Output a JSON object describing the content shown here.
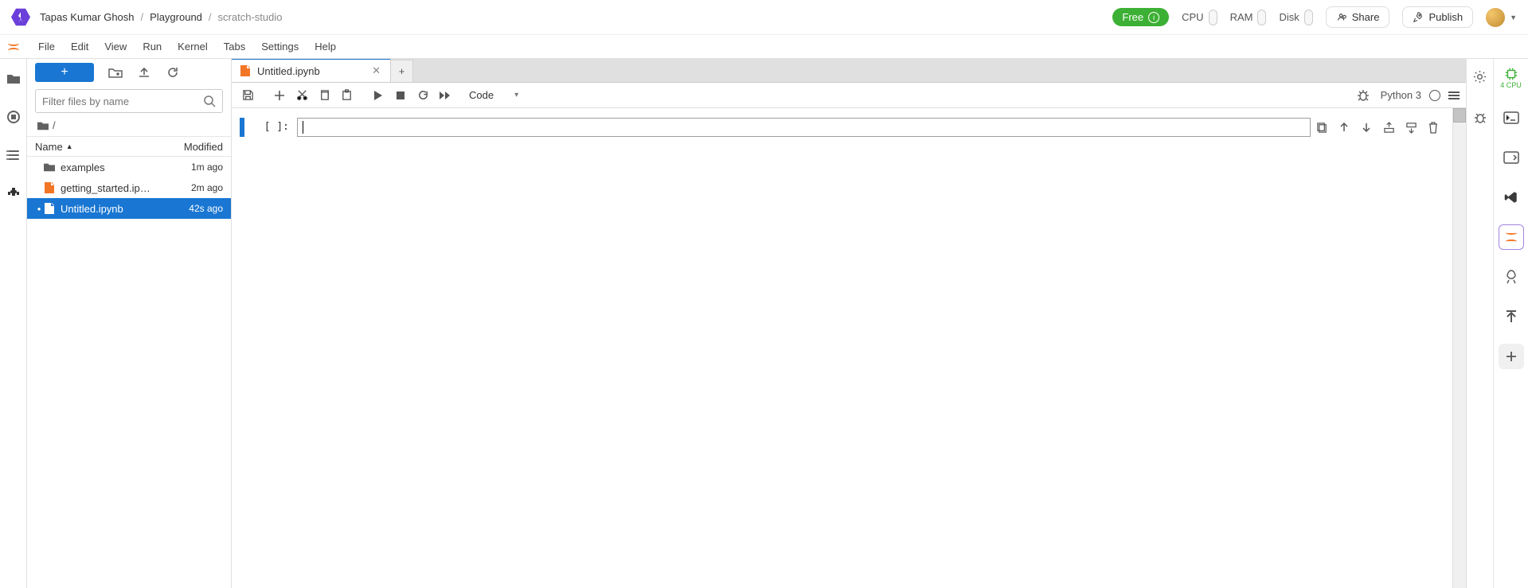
{
  "breadcrumbs": {
    "owner": "Tapas Kumar Ghosh",
    "folder": "Playground",
    "project": "scratch-studio"
  },
  "plan": {
    "label": "Free"
  },
  "metrics": {
    "cpu": "CPU",
    "ram": "RAM",
    "disk": "Disk"
  },
  "actions": {
    "share": "Share",
    "publish": "Publish"
  },
  "menu": {
    "file": "File",
    "edit": "Edit",
    "view": "View",
    "run": "Run",
    "kernel": "Kernel",
    "tabs": "Tabs",
    "settings": "Settings",
    "help": "Help"
  },
  "filebrowser": {
    "filter_placeholder": "Filter files by name",
    "path_root": "/",
    "col_name": "Name",
    "col_modified": "Modified",
    "items": [
      {
        "icon": "folder",
        "name": "examples",
        "modified": "1m ago",
        "selected": false,
        "dirty": false
      },
      {
        "icon": "notebook",
        "name": "getting_started.ip…",
        "modified": "2m ago",
        "selected": false,
        "dirty": false
      },
      {
        "icon": "notebook",
        "name": "Untitled.ipynb",
        "modified": "42s ago",
        "selected": true,
        "dirty": true
      }
    ]
  },
  "tab": {
    "title": "Untitled.ipynb"
  },
  "celltype": "Code",
  "kernel": {
    "name": "Python 3"
  },
  "cell": {
    "prompt": "[  ]:"
  },
  "rightrail": {
    "cpu_count": "4 CPU"
  }
}
